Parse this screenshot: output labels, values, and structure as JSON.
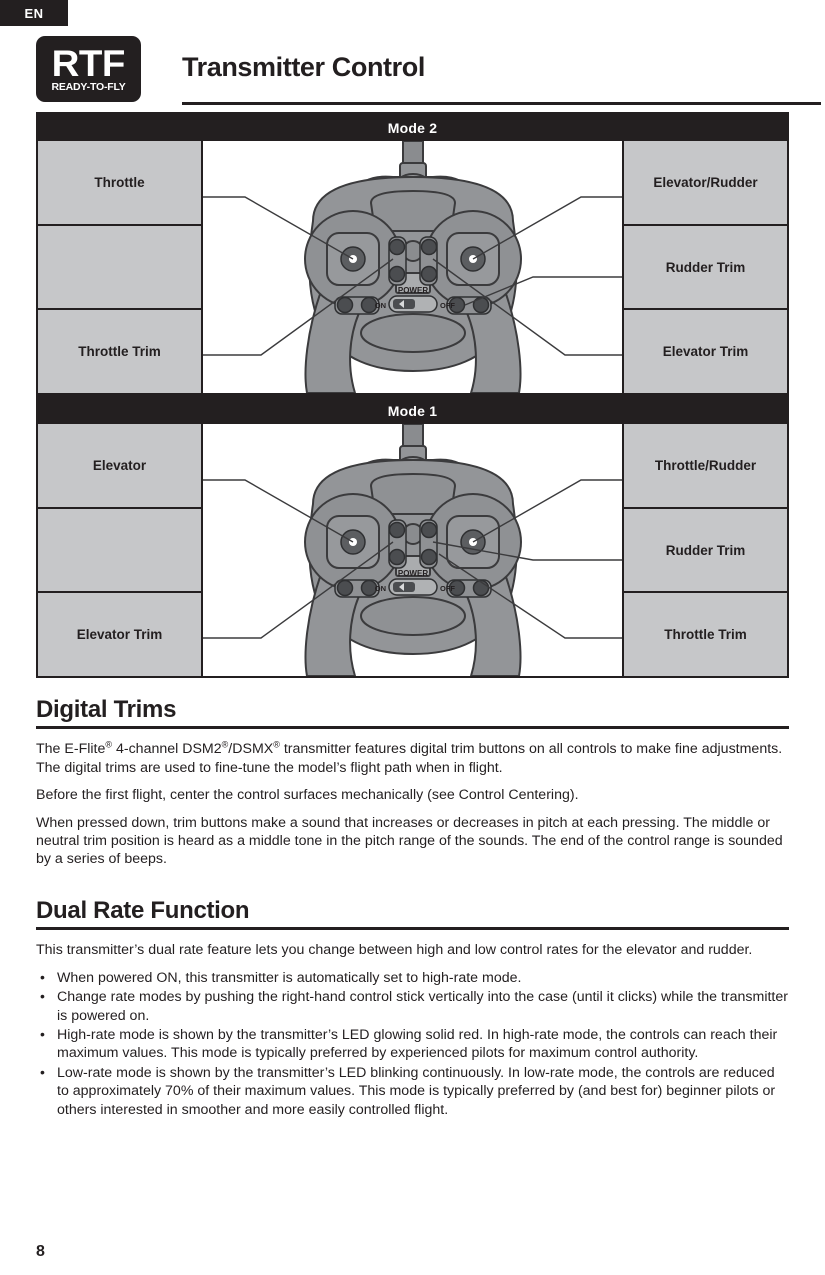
{
  "language_tab": "EN",
  "header": {
    "logo_main": "RTF",
    "logo_sub": "READY-TO-FLY",
    "title": "Transmitter Control"
  },
  "modes": [
    {
      "bar_label": "Mode 2",
      "left_labels": [
        "Throttle",
        "",
        "Throttle Trim"
      ],
      "right_labels": [
        "Elevator/Rudder",
        "Rudder Trim",
        "Elevator Trim"
      ],
      "switch": {
        "name": "POWER",
        "on": "ON",
        "off": "OFF"
      }
    },
    {
      "bar_label": "Mode 1",
      "left_labels": [
        "Elevator",
        "",
        "Elevator Trim"
      ],
      "right_labels": [
        "Throttle/Rudder",
        "Rudder Trim",
        "Throttle Trim"
      ],
      "switch": {
        "name": "POWER",
        "on": "ON",
        "off": "OFF"
      }
    }
  ],
  "digital_trims": {
    "heading": "Digital Trims",
    "paragraph_1_a": "The E-Flite",
    "paragraph_1_sup1": "®",
    "paragraph_1_b": " 4-channel DSM2",
    "paragraph_1_sup2": "®",
    "paragraph_1_c": "/DSMX",
    "paragraph_1_sup3": "®",
    "paragraph_1_d": " transmitter features digital trim buttons on all controls to make fine adjustments. The digital trims are used to fine-tune the model’s flight path when in flight.",
    "paragraph_2": "Before the first flight, center the control surfaces mechanically (see Control Centering).",
    "paragraph_3": "When pressed down, trim buttons make a sound that increases or decreases in pitch at each pressing. The middle or neutral trim position is heard as a middle tone in the pitch range of the sounds. The end of the control range is sounded by a series of beeps."
  },
  "dual_rate": {
    "heading": "Dual Rate Function",
    "intro": "This transmitter’s dual rate feature lets you change between high and low control rates for the elevator and rudder.",
    "bullets": [
      "When powered ON, this transmitter is automatically set to high-rate mode.",
      "Change rate modes by pushing the right-hand control stick vertically into the case (until it clicks) while the transmitter is powered on.",
      "High-rate mode is shown by the transmitter’s LED glowing solid red. In high-rate mode, the controls can reach their maximum values. This mode is typically preferred by experienced pilots for maximum control authority.",
      "Low-rate mode is shown by the transmitter’s LED blinking continuously. In low-rate mode, the controls are reduced to approximately 70% of their maximum values. This mode is typically preferred by (and best for) beginner pilots or others interested in smoother and more easily controlled flight."
    ]
  },
  "page_number": "8",
  "colors": {
    "ink": "#231f20",
    "panel_gray": "#c6c7c9",
    "tx_body": "#939598",
    "tx_outline": "#3b3b3d"
  }
}
